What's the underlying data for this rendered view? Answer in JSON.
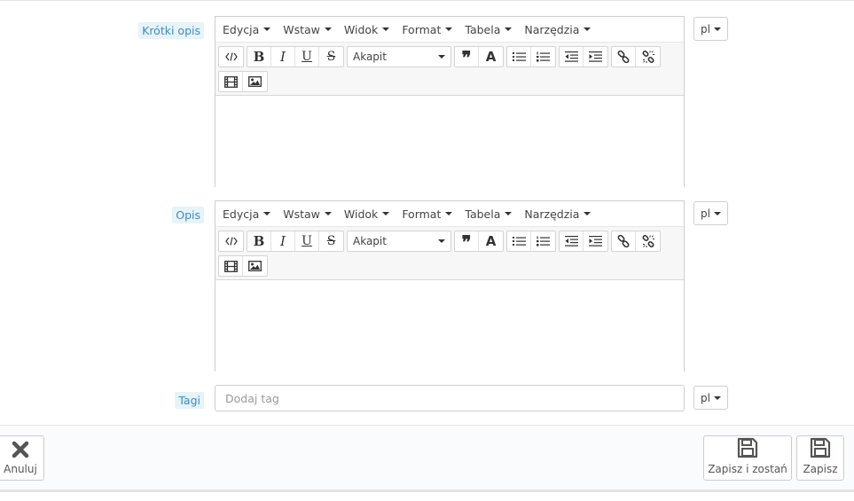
{
  "fields": {
    "short_description": {
      "label": "Krótki opis",
      "lang": "pl"
    },
    "description": {
      "label": "Opis",
      "lang": "pl"
    },
    "tags": {
      "label": "Tagi",
      "placeholder": "Dodaj tag",
      "lang": "pl"
    }
  },
  "editor": {
    "menus": [
      "Edycja",
      "Wstaw",
      "Widok",
      "Format",
      "Tabela",
      "Narzędzia"
    ],
    "block_format": "Akapit",
    "buttons": [
      "source-code",
      "bold",
      "italic",
      "underline",
      "strikethrough",
      "blockquote",
      "text-color",
      "bullet-list",
      "numbered-list",
      "outdent",
      "indent",
      "link",
      "unlink",
      "media",
      "image"
    ]
  },
  "footer": {
    "cancel_label": "Anuluj",
    "save_stay_label": "Zapisz i zostań",
    "save_label": "Zapisz"
  },
  "colors": {
    "label_bg": "#e8f3f9",
    "label_text": "#3a8ec2"
  }
}
